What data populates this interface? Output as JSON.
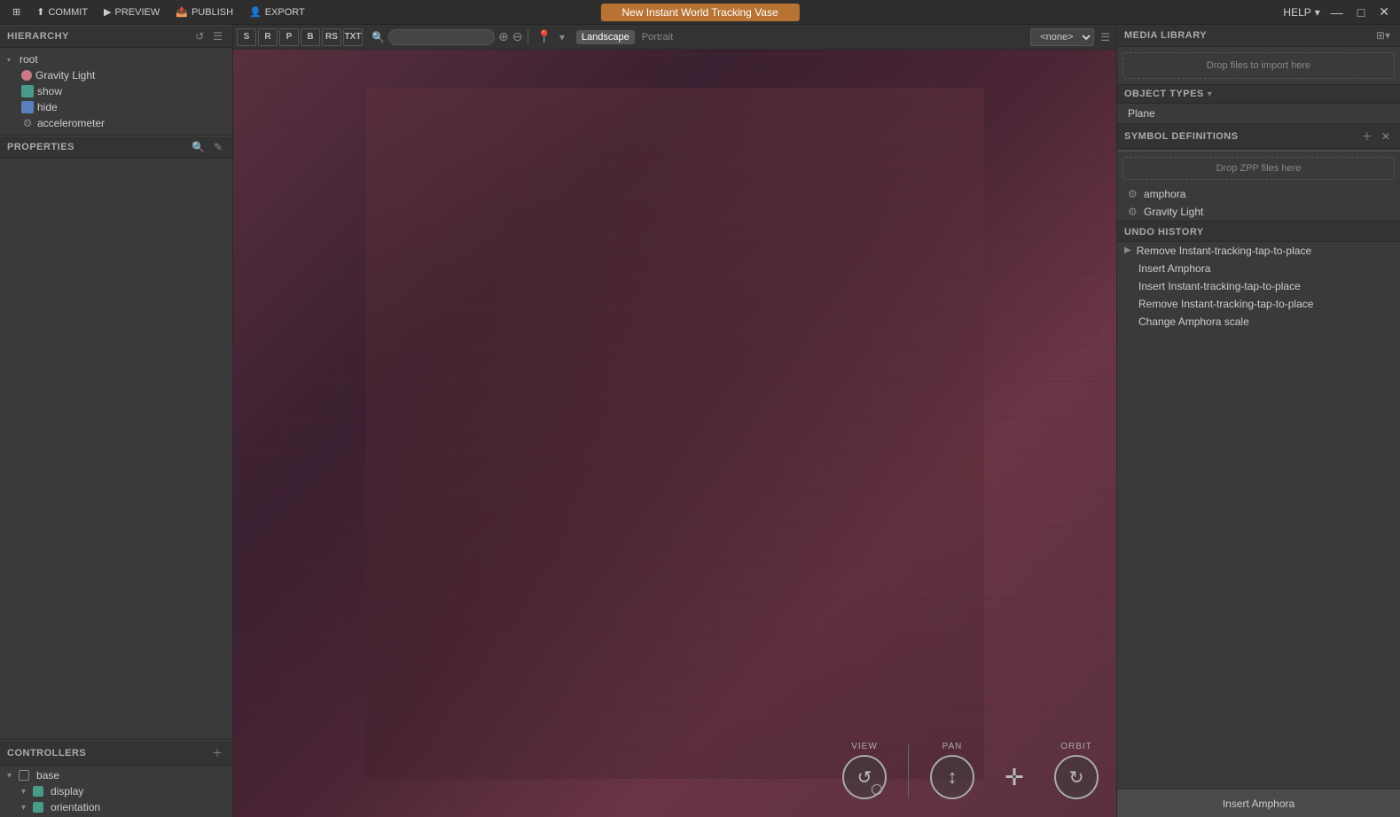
{
  "topbar": {
    "commit_label": "COMMIT",
    "preview_label": "PREVIEW",
    "publish_label": "PUBLISH",
    "export_label": "EXPORT",
    "title": "New Instant World Tracking Vase",
    "help_label": "HELP",
    "window_minimize": "—",
    "window_restore": "□",
    "window_close": "✕"
  },
  "hierarchy": {
    "title": "HIERARCHY",
    "items": [
      {
        "id": "root",
        "label": "root",
        "indent": 0,
        "type": "arrow",
        "icon": "arrow"
      },
      {
        "id": "gravity-light",
        "label": "Gravity Light",
        "indent": 1,
        "type": "pink"
      },
      {
        "id": "show",
        "label": "show",
        "indent": 1,
        "type": "teal"
      },
      {
        "id": "hide",
        "label": "hide",
        "indent": 1,
        "type": "blue"
      },
      {
        "id": "accelerometer",
        "label": "accelerometer",
        "indent": 1,
        "type": "gear"
      }
    ]
  },
  "properties": {
    "title": "PROPERTIES"
  },
  "controllers": {
    "title": "CONTROLLERS",
    "items": [
      {
        "id": "base",
        "label": "base",
        "indent": 0,
        "type": "checkbox"
      },
      {
        "id": "display",
        "label": "display",
        "indent": 1,
        "type": "teal"
      },
      {
        "id": "orientation",
        "label": "orientation",
        "indent": 1,
        "type": "teal"
      }
    ]
  },
  "canvas": {
    "tools": [
      "S",
      "R",
      "P",
      "B",
      "RS",
      "TXT"
    ],
    "view_modes": [
      "Landscape",
      "Portrait"
    ],
    "active_view": "Landscape",
    "dropdown_value": "<none>",
    "controls": {
      "view_label": "VIEW",
      "pan_label": "PAN",
      "orbit_label": "ORBIT"
    }
  },
  "right_panel": {
    "media_library": {
      "title": "MEDIA LIBRARY",
      "drop_text": "Drop files to import here"
    },
    "object_types": {
      "title": "OBJECT TYPES",
      "items": [
        "Plane"
      ]
    },
    "symbol_definitions": {
      "title": "SYMBOL DEFINITIONS",
      "drop_text": "Drop ZPP files here",
      "items": [
        {
          "id": "amphora",
          "label": "amphora"
        },
        {
          "id": "gravity-light",
          "label": "Gravity Light"
        }
      ]
    },
    "undo_history": {
      "title": "UNDO HISTORY",
      "items": [
        {
          "id": "remove-instant",
          "label": "Remove Instant-tracking-tap-to-place",
          "expanded": true
        },
        {
          "id": "insert-amphora",
          "label": "Insert Amphora"
        },
        {
          "id": "insert-instant",
          "label": "Insert Instant-tracking-tap-to-place"
        },
        {
          "id": "remove-instant2",
          "label": "Remove Instant-tracking-tap-to-place"
        },
        {
          "id": "change-amphora",
          "label": "Change Amphora scale"
        }
      ]
    },
    "insert_btn_label": "Insert Amphora"
  }
}
